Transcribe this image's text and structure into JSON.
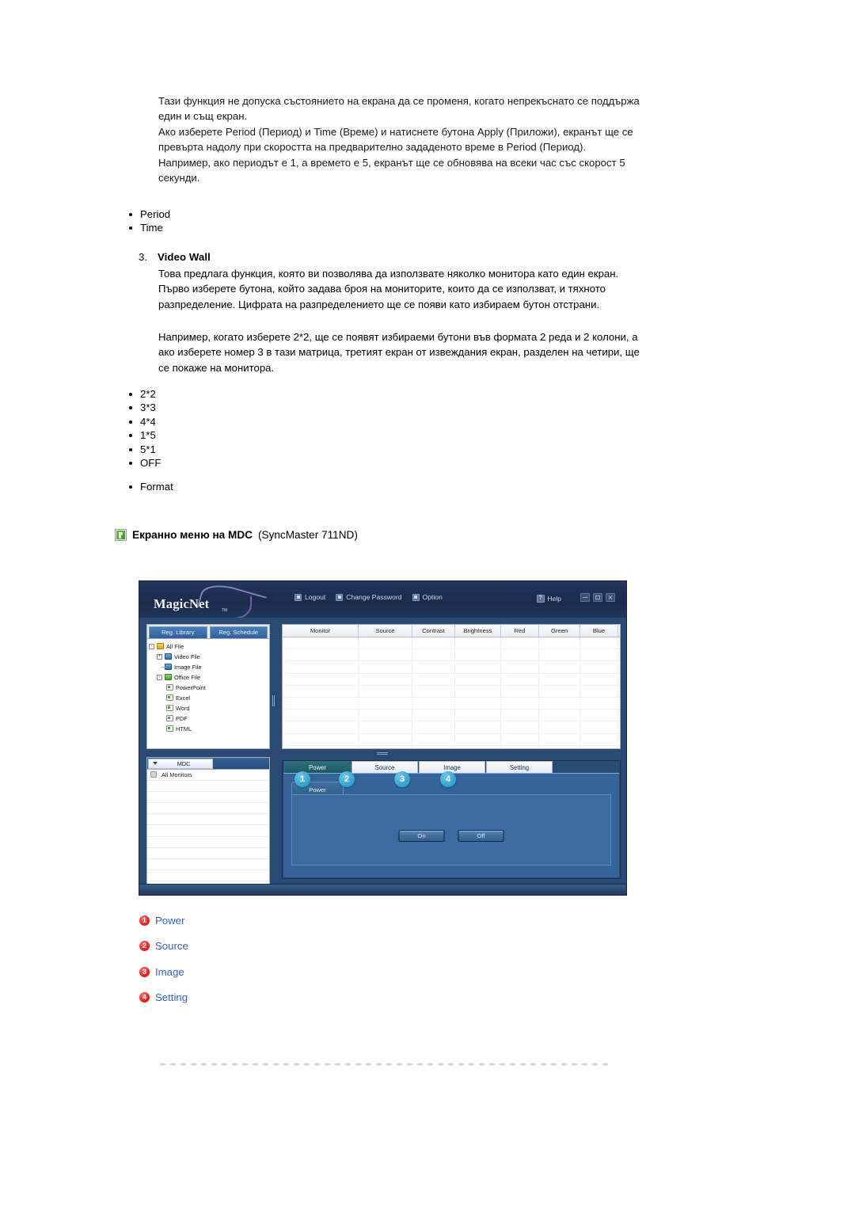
{
  "intro": {
    "paragraphs": [
      "Тази функция не допуска състоянието на екрана да се променя, когато непрекъснато се поддържа един и същ екран.",
      "Ако изберете Period (Период) и Time (Време) и натиснете бутона Apply (Приложи), екранът ще се превърта надолу при скоростта на предварително зададеното време в Period (Период).",
      "Например, ако периодът е 1, а времето е 5, екранът ще се обновява на всеки час със скорост 5 секунди."
    ]
  },
  "bullets_period": [
    "Period",
    "Time"
  ],
  "video_wall": {
    "number": "3.",
    "title": "Video Wall",
    "para1": "Това предлага функция, която ви позволява да използвате няколко монитора като един екран. Първо изберете бутона, който задава броя на мониторите, които да се използват, и тяхното разпределение. Цифрата на разпределението ще се появи като избираем бутон отстрани.",
    "para2": "Например, когато изберете 2*2, ще се появят избираеми бутони във формата 2 реда и 2 колони, а ако изберете номер 3 в тази матрица, третият екран от извеждания екран, разделен на четири, ще се покаже на монитора.",
    "options": [
      "2*2",
      "3*3",
      "4*4",
      "1*5",
      "5*1",
      "OFF"
    ],
    "format": [
      "Format"
    ]
  },
  "section": {
    "icon": "green-square-icon",
    "title": "Екранно меню на MDC",
    "subtitle": "(SyncMaster 711ND)"
  },
  "app": {
    "logo": "MagicNet",
    "logo_tm": "TM",
    "menu": [
      {
        "label": "Logout",
        "icon": "logout-icon"
      },
      {
        "label": "Change Password",
        "icon": "key-icon"
      },
      {
        "label": "Option",
        "icon": "option-icon"
      }
    ],
    "help": {
      "label": "Help",
      "icon": "question-icon"
    },
    "window_controls": [
      "minimize-button",
      "maximize-button",
      "close-button"
    ],
    "library": {
      "tabs": [
        "Reg. Library",
        "Reg. Schedule"
      ],
      "tree": [
        {
          "label": "All File",
          "level": 0,
          "toggle": "-",
          "icon": "folder-yellow-icon"
        },
        {
          "label": "Video File",
          "level": 1,
          "toggle": "+",
          "icon": "folder-blue-icon"
        },
        {
          "label": "Image File",
          "level": 1,
          "toggle": "",
          "icon": "folder-blue-icon"
        },
        {
          "label": "Office File",
          "level": 1,
          "toggle": "-",
          "icon": "folder-green-icon"
        },
        {
          "label": "PowerPoint",
          "level": 2,
          "toggle": "",
          "icon": "document-icon"
        },
        {
          "label": "Excel",
          "level": 2,
          "toggle": "",
          "icon": "document-icon"
        },
        {
          "label": "Word",
          "level": 2,
          "toggle": "",
          "icon": "document-icon"
        },
        {
          "label": "PDF",
          "level": 2,
          "toggle": "",
          "icon": "document-icon"
        },
        {
          "label": "HTML",
          "level": 2,
          "toggle": "",
          "icon": "document-icon"
        }
      ]
    },
    "mdc_panel": {
      "tab_label": "MDC",
      "rows": [
        "All Monitors",
        "",
        "",
        "",
        "",
        "",
        "",
        "",
        "",
        "",
        ""
      ]
    },
    "grid": {
      "columns": [
        "Monitor",
        "Source",
        "Contrast",
        "Brightness",
        "Red",
        "Green",
        "Blue"
      ],
      "rows": []
    },
    "control": {
      "tabs": [
        "Power",
        "Source",
        "Image",
        "Setting"
      ],
      "active_tab": "Power",
      "sub_tab": "Power",
      "buttons": [
        "On",
        "Off"
      ],
      "badges": [
        "1",
        "2",
        "3",
        "4"
      ]
    }
  },
  "legend": [
    {
      "num": "1",
      "label": "Power"
    },
    {
      "num": "2",
      "label": "Source"
    },
    {
      "num": "3",
      "label": "Image"
    },
    {
      "num": "4",
      "label": "Setting"
    }
  ],
  "colors": {
    "app_header": "#1e3255",
    "app_panel": "#2a4a74",
    "badge_blue": "#39a9d6",
    "legend_red": "#e8201f",
    "legend_text": "#2d63d6",
    "icon_green": "#2f9b16"
  }
}
